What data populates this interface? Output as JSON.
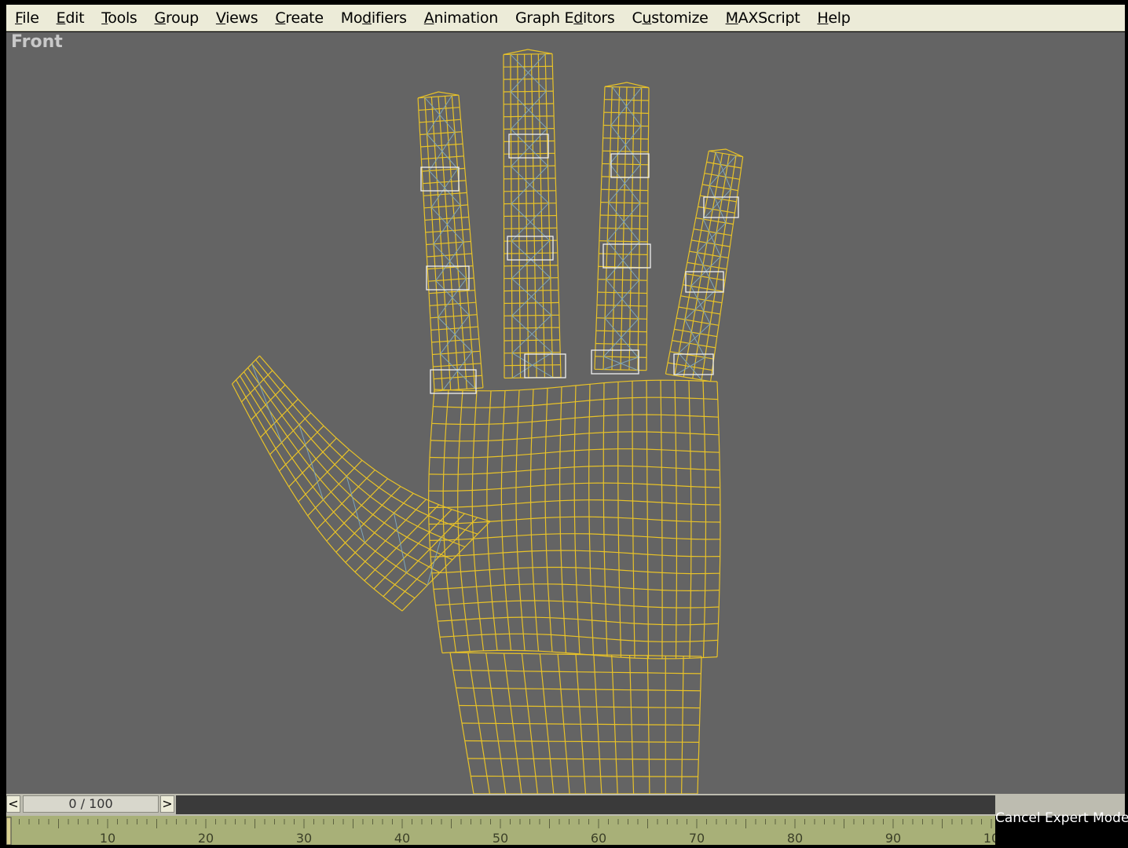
{
  "menu": [
    {
      "pre": "",
      "ul": "F",
      "post": "ile"
    },
    {
      "pre": "",
      "ul": "E",
      "post": "dit"
    },
    {
      "pre": "",
      "ul": "T",
      "post": "ools"
    },
    {
      "pre": "",
      "ul": "G",
      "post": "roup"
    },
    {
      "pre": "",
      "ul": "V",
      "post": "iews"
    },
    {
      "pre": "",
      "ul": "C",
      "post": "reate"
    },
    {
      "pre": "Mo",
      "ul": "d",
      "post": "ifiers"
    },
    {
      "pre": "",
      "ul": "A",
      "post": "nimation"
    },
    {
      "pre": "Graph E",
      "ul": "d",
      "post": "itors"
    },
    {
      "pre": "C",
      "ul": "u",
      "post": "stomize"
    },
    {
      "pre": "",
      "ul": "M",
      "post": "AXScript"
    },
    {
      "pre": "",
      "ul": "H",
      "post": "elp"
    }
  ],
  "viewport": {
    "label": "Front"
  },
  "timeslider": {
    "prev": "<",
    "value": "0 / 100",
    "next": ">"
  },
  "trackbar": {
    "ticks": [
      "10",
      "20",
      "30",
      "40",
      "50",
      "60",
      "70",
      "80",
      "90",
      "10"
    ]
  },
  "status": {
    "cancel_expert": "Cancel Expert Mode"
  },
  "colors": {
    "wire": "#e8c228",
    "bone": "#7fa6b8",
    "viewport_bg": "#646464"
  }
}
